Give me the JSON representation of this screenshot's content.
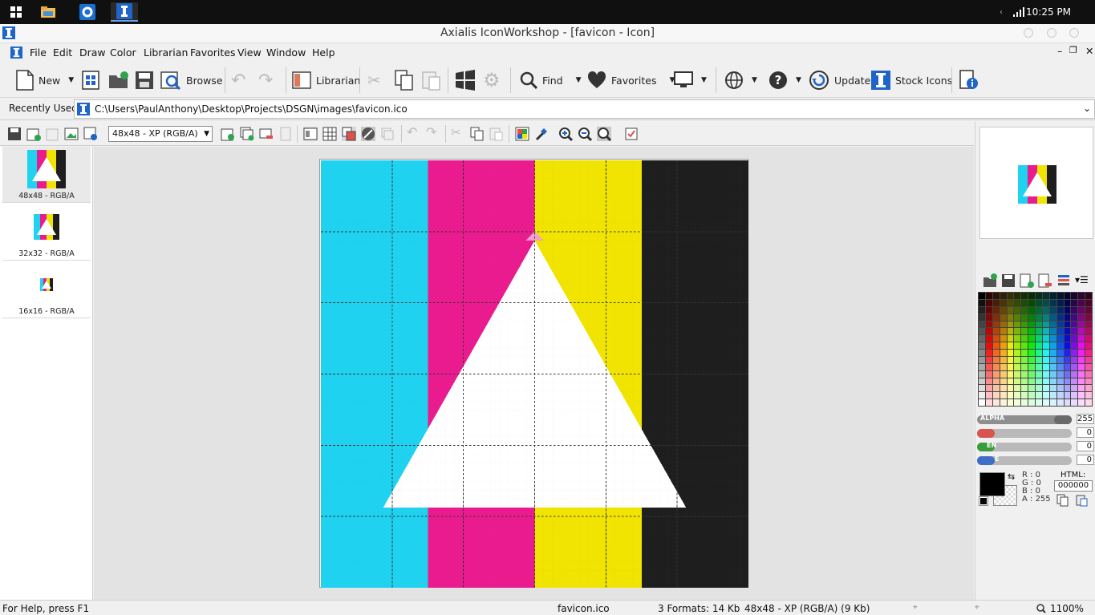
{
  "taskbar": {
    "time": "10:25 PM"
  },
  "window": {
    "title": "Axialis IconWorkshop - [favicon - Icon]"
  },
  "menu": [
    "File",
    "Edit",
    "Draw",
    "Color",
    "Librarian",
    "Favorites",
    "View",
    "Window",
    "Help"
  ],
  "toolbar": {
    "new": "New",
    "browse": "Browse",
    "librarian": "Librarian",
    "find": "Find",
    "favorites": "Favorites",
    "update": "Update",
    "stock_icons": "Stock Icons"
  },
  "address": {
    "label": "Recently Used",
    "path": "C:\\Users\\PaulAnthony\\Desktop\\Projects\\DSGN\\images\\favicon.ico"
  },
  "format_select": {
    "value": "48x48 - XP (RGB/A)"
  },
  "formats": [
    {
      "label": "48x48 - RGB/A"
    },
    {
      "label": "32x32 - RGB/A"
    },
    {
      "label": "16x16 - RGB/A"
    }
  ],
  "color_panel": {
    "alpha_label": "ALPHA",
    "alpha_value": "255",
    "red_value": "0",
    "green_label": "EN",
    "green_value": "0",
    "blue_label": "E",
    "blue_value": "0",
    "rgb_readout": {
      "r": "R :  0",
      "g": "G :  0",
      "b": "B :  0",
      "a": "A : 255"
    },
    "html_label": "HTML:",
    "html_value": "000000",
    "current_color": "#000000"
  },
  "status": {
    "help": "For Help, press F1",
    "file": "favicon.ico",
    "formats": "3 Formats: 14 Kb",
    "format_info": "48x48 - XP (RGB/A) (9 Kb)",
    "zoom": "1100%"
  },
  "icon_colors": {
    "cyan": "#1ed2f0",
    "magenta": "#ea1b8e",
    "yellow": "#f0e400",
    "black": "#1e1e1e",
    "white": "#ffffff"
  }
}
